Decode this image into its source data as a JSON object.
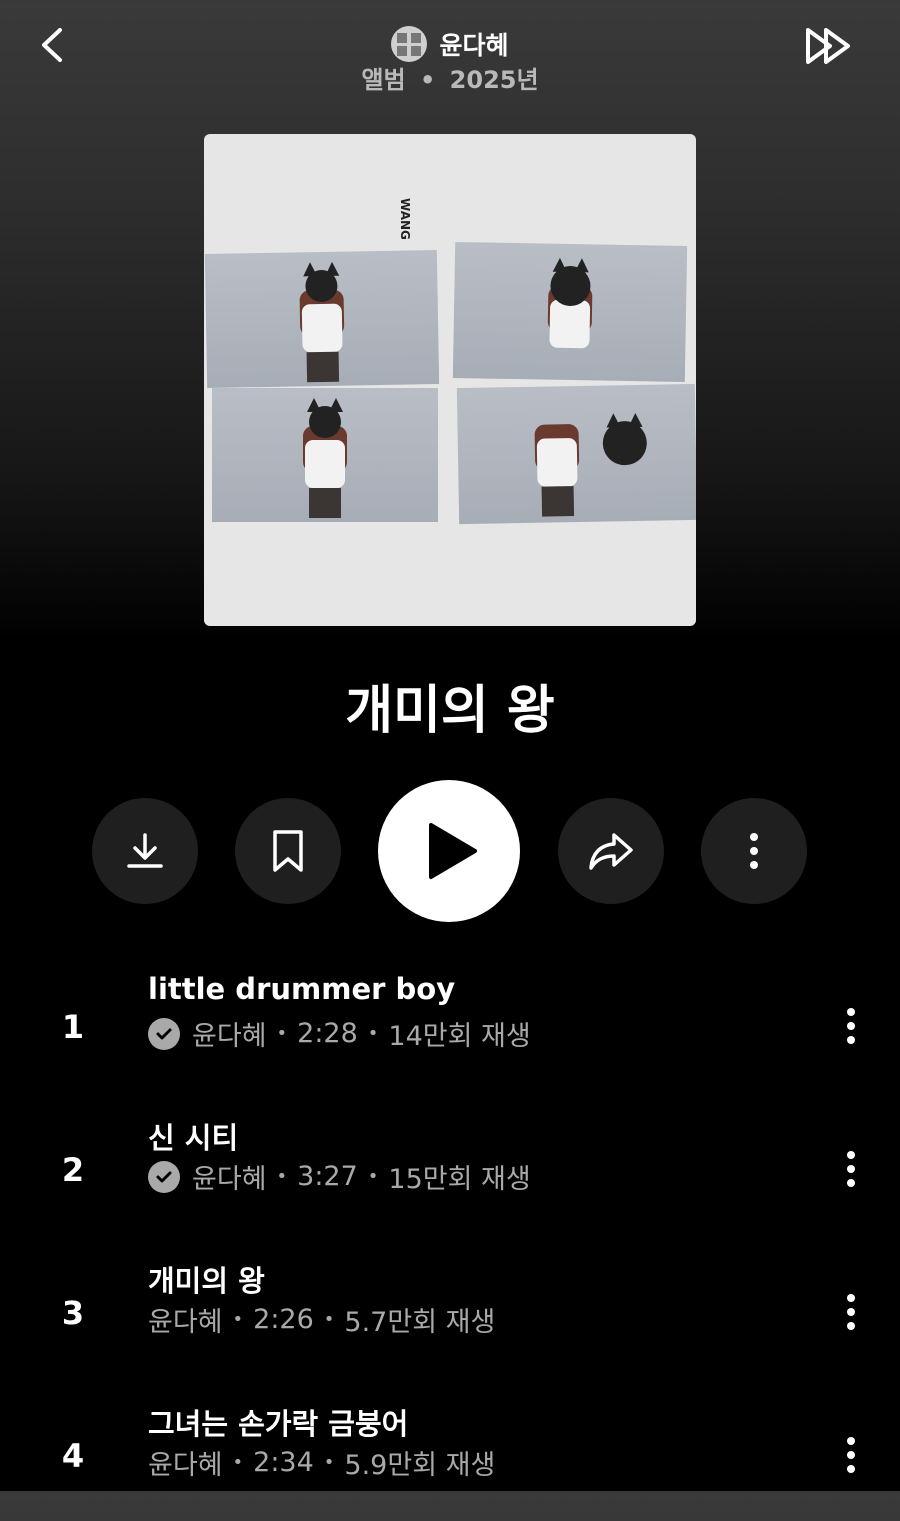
{
  "header": {
    "artist_name": "윤다혜",
    "album_type": "앨범",
    "year": "2025년",
    "separator": "•"
  },
  "cover": {
    "text": "WANG"
  },
  "album": {
    "title": "개미의 왕"
  },
  "actions": [
    "download-icon",
    "bookmark-icon",
    "play-icon",
    "share-icon",
    "more-vertical-icon"
  ],
  "tracks": [
    {
      "number": "1",
      "title": "little drummer boy",
      "verified": true,
      "artist": "윤다혜",
      "duration": "2:28",
      "plays": "14만회 재생"
    },
    {
      "number": "2",
      "title": "신 시티",
      "verified": true,
      "artist": "윤다혜",
      "duration": "3:27",
      "plays": "15만회 재생"
    },
    {
      "number": "3",
      "title": "개미의 왕",
      "verified": false,
      "artist": "윤다혜",
      "duration": "2:26",
      "plays": "5.7만회 재생"
    },
    {
      "number": "4",
      "title": "그녀는 손가락 금붕어",
      "verified": false,
      "artist": "윤다혜",
      "duration": "2:34",
      "plays": "5.9만회 재생"
    }
  ]
}
